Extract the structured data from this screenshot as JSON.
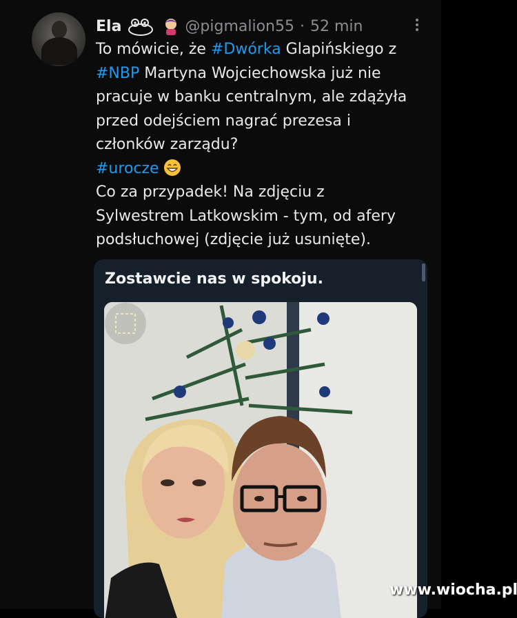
{
  "tweet": {
    "display_name": "Ela",
    "handle": "@pigmalion55",
    "separator": "·",
    "time": "52 min",
    "lines": [
      [
        {
          "t": "To mówicie, że "
        },
        {
          "t": "#Dwórka",
          "tag": true
        },
        {
          "t": " Glapińskiego z"
        }
      ],
      [
        {
          "t": "#NBP",
          "tag": true
        },
        {
          "t": " Martyna Wojciechowska już nie"
        }
      ],
      [
        {
          "t": "pracuje w banku centralnym, ale zdążyła"
        }
      ],
      [
        {
          "t": "przed odejściem nagrać prezesa i"
        }
      ],
      [
        {
          "t": "członków zarządu?"
        }
      ],
      [
        {
          "t": "#urocze",
          "tag": true
        }
      ],
      [
        {
          "t": "Co za przypadek! Na zdjęciu z"
        }
      ],
      [
        {
          "t": "Sylwestrem Latkowskim - tym, od afery"
        }
      ],
      [
        {
          "t": "podsłuchowej (zdjęcie już usunięte)."
        }
      ]
    ]
  },
  "quote": {
    "text": "Zostawcie nas w spokoju."
  },
  "icons": {
    "name_emoji_1": "frog-emoji-icon",
    "name_emoji_2": "pig-emoji-icon",
    "reaction": "grinning-face-icon",
    "more": "more-options-icon",
    "expand": "expand-media-icon"
  },
  "colors": {
    "hashtag": "#1d9bf0",
    "muted": "#8a8d91",
    "text": "#e7e9ea",
    "background": "#000000",
    "quote_background": "#15202b"
  },
  "watermark": "www.wiocha.pl"
}
